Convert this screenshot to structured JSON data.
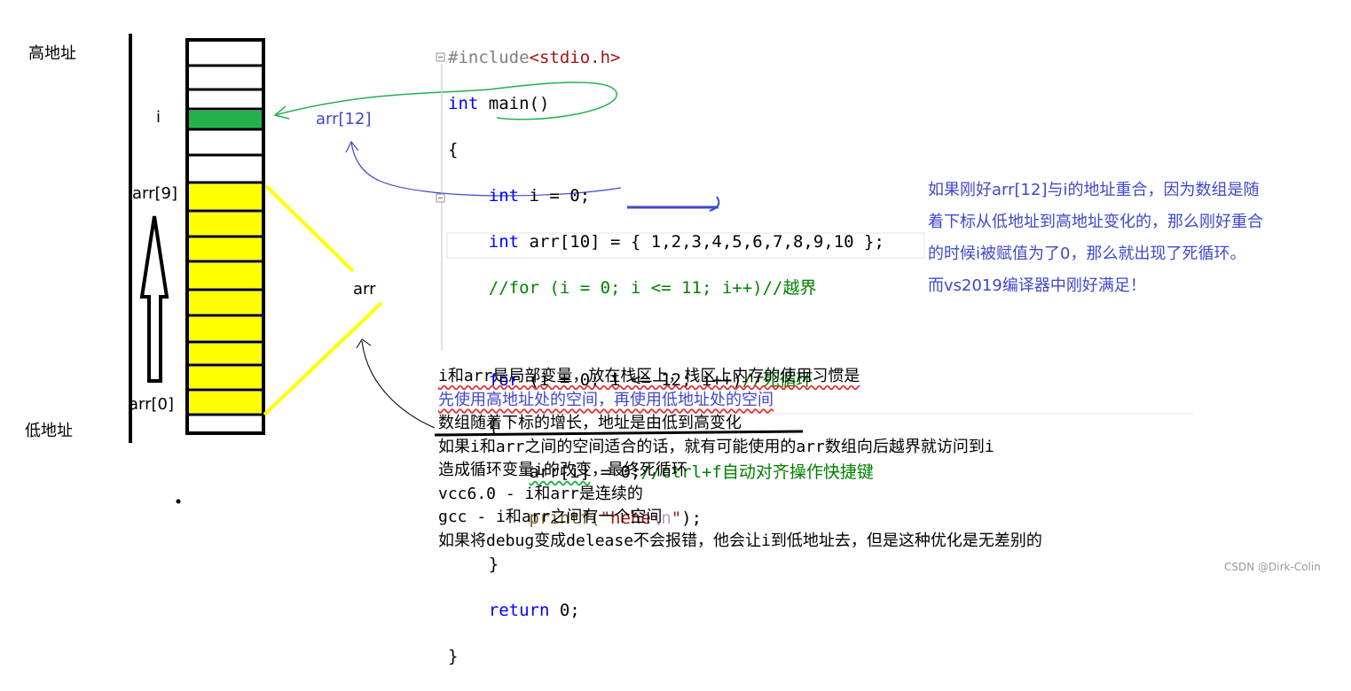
{
  "labels": {
    "high_addr": "高地址",
    "low_addr": "低地址",
    "i": "i",
    "arr9": "arr[9]",
    "arr0": "arr[0]",
    "arr": "arr",
    "arr12": "arr[12]"
  },
  "code": {
    "include": "#include",
    "include_target": "<stdio.h>",
    "int": "int",
    "main": " main()",
    "open_brace": "{",
    "line_i": " i = 0;",
    "line_arr": " arr[10] = { 1,2,3,4,5,6,7,8,9,10 };",
    "comment_for": "//for (i = 0; i <= 11; i++)//越界",
    "for": "for",
    "for_rest1": " (i = 0; ",
    "for_cond": "i <= 12; ",
    "for_rest2": "i++)",
    "for_comment": "//死循环",
    "arr_assign": "arr[i]",
    "arr_assign_rest": " = 0;",
    "arr_assign_comment": "//ctrl+f自动对齐操作快捷键",
    "printf": "printf(",
    "printf_str1": "\"hehe",
    "printf_esc": "\\n",
    "printf_str2": "\"",
    "printf_end": ");",
    "close_brace_inner": "}",
    "return": "return",
    "return_rest": " 0;",
    "close_brace": "}"
  },
  "blue_note": [
    "如果刚好arr[12]与i的地址重合，因为数组是随",
    "着下标从低地址到高地址变化的，那么刚好重合",
    "的时候i被赋值为了0，那么就出现了死循环。",
    "而vs2019编译器中刚好满足！"
  ],
  "notes": [
    "i和arr是局部变量，放在栈区上，栈区上内存的使用习惯是",
    "先使用高地址处的空间，再使用低地址处的空间",
    "数组随着下标的增长，地址是由低到高变化",
    "如果i和arr之间的空间适合的话，就有可能使用的arr数组向后越界就访问到i",
    "造成循环变量i的改变，最终死循环",
    "vcc6.0 - i和arr是连续的",
    "gcc - i和arr之间有一个空间",
    "如果将debug变成delease不会报错，他会让i到低地址去，但是这种优化是无差别的"
  ],
  "watermark": "CSDN @Dirk-Colin",
  "colors": {
    "yellow_cell": "#ffff00",
    "green_cell": "#22b14c",
    "blue_note": "#3f48cc",
    "green_arrow": "#22b14c",
    "blue_arrow": "#3f48cc"
  }
}
